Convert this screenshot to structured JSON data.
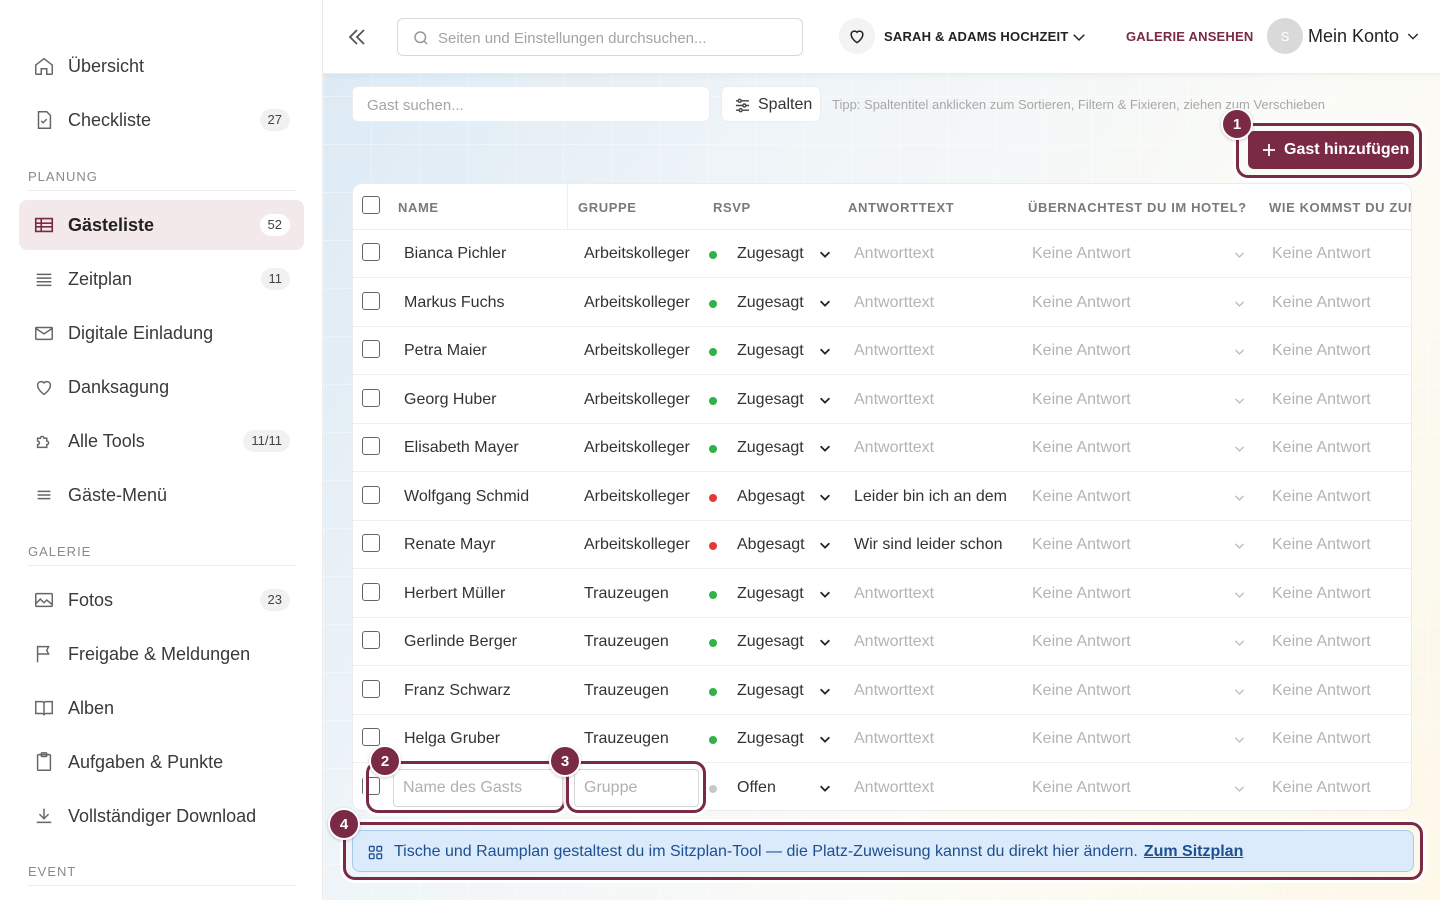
{
  "sidebar": {
    "top_items": [
      {
        "label": "Übersicht",
        "badge": null,
        "icon": "home-icon"
      },
      {
        "label": "Checkliste",
        "badge": "27",
        "icon": "checklist-icon"
      }
    ],
    "sections": [
      {
        "title": "PLANUNG"
      },
      {
        "title": "GALERIE"
      },
      {
        "title": "EVENT"
      }
    ],
    "planung_items": [
      {
        "label": "Gästeliste",
        "badge": "52",
        "icon": "table-icon"
      },
      {
        "label": "Zeitplan",
        "badge": "11",
        "icon": "lines-icon"
      },
      {
        "label": "Digitale Einladung",
        "badge": null,
        "icon": "mail-icon"
      },
      {
        "label": "Danksagung",
        "badge": null,
        "icon": "heart-icon"
      },
      {
        "label": "Alle Tools",
        "badge": "11/11",
        "icon": "puzzle-icon"
      },
      {
        "label": "Gäste-Menü",
        "badge": null,
        "icon": "menu-icon"
      }
    ],
    "galerie_items": [
      {
        "label": "Fotos",
        "badge": "23",
        "icon": "image-icon"
      },
      {
        "label": "Freigabe & Meldungen",
        "badge": null,
        "icon": "flag-icon"
      },
      {
        "label": "Alben",
        "badge": null,
        "icon": "book-icon"
      },
      {
        "label": "Aufgaben & Punkte",
        "badge": null,
        "icon": "clipboard-icon"
      },
      {
        "label": "Vollständiger Download",
        "badge": null,
        "icon": "download-icon"
      }
    ]
  },
  "topbar": {
    "search_placeholder": "Seiten und Einstellungen durchsuchen...",
    "event_name": "SARAH & ADAMS HOCHZEIT",
    "gallery_link": "GALERIE ANSEHEN",
    "avatar_initial": "S",
    "account_label": "Mein Konto"
  },
  "toolbar": {
    "guest_search_placeholder": "Gast suchen...",
    "columns_label": "Spalten",
    "tip": "Tipp: Spaltentitel anklicken zum Sortieren, Filtern & Fixieren, ziehen zum Verschieben",
    "add_guest_label": "Gast hinzufügen"
  },
  "table": {
    "headers": [
      "NAME",
      "GRUPPE",
      "RSVP",
      "ANTWORTTEXT",
      "ÜBERNACHTEST DU IM HOTEL?",
      "WIE KOMMST DU ZUM"
    ],
    "rows": [
      {
        "name": "Bianca Pichler",
        "group": "Arbeitskolleger",
        "rsvp": "Zugesagt",
        "status": "yes",
        "text": "Antworttext",
        "text_placeholder": true,
        "hotel": "Keine Antwort",
        "travel": "Keine Antwort"
      },
      {
        "name": "Markus Fuchs",
        "group": "Arbeitskolleger",
        "rsvp": "Zugesagt",
        "status": "yes",
        "text": "Antworttext",
        "text_placeholder": true,
        "hotel": "Keine Antwort",
        "travel": "Keine Antwort"
      },
      {
        "name": "Petra Maier",
        "group": "Arbeitskolleger",
        "rsvp": "Zugesagt",
        "status": "yes",
        "text": "Antworttext",
        "text_placeholder": true,
        "hotel": "Keine Antwort",
        "travel": "Keine Antwort"
      },
      {
        "name": "Georg Huber",
        "group": "Arbeitskolleger",
        "rsvp": "Zugesagt",
        "status": "yes",
        "text": "Antworttext",
        "text_placeholder": true,
        "hotel": "Keine Antwort",
        "travel": "Keine Antwort"
      },
      {
        "name": "Elisabeth Mayer",
        "group": "Arbeitskolleger",
        "rsvp": "Zugesagt",
        "status": "yes",
        "text": "Antworttext",
        "text_placeholder": true,
        "hotel": "Keine Antwort",
        "travel": "Keine Antwort"
      },
      {
        "name": "Wolfgang Schmid",
        "group": "Arbeitskolleger",
        "rsvp": "Abgesagt",
        "status": "no",
        "text": "Leider bin ich an dem",
        "text_placeholder": false,
        "hotel": "Keine Antwort",
        "travel": "Keine Antwort"
      },
      {
        "name": "Renate Mayr",
        "group": "Arbeitskolleger",
        "rsvp": "Abgesagt",
        "status": "no",
        "text": "Wir sind leider schon",
        "text_placeholder": false,
        "hotel": "Keine Antwort",
        "travel": "Keine Antwort"
      },
      {
        "name": "Herbert Müller",
        "group": "Trauzeugen",
        "rsvp": "Zugesagt",
        "status": "yes",
        "text": "Antworttext",
        "text_placeholder": true,
        "hotel": "Keine Antwort",
        "travel": "Keine Antwort"
      },
      {
        "name": "Gerlinde Berger",
        "group": "Trauzeugen",
        "rsvp": "Zugesagt",
        "status": "yes",
        "text": "Antworttext",
        "text_placeholder": true,
        "hotel": "Keine Antwort",
        "travel": "Keine Antwort"
      },
      {
        "name": "Franz Schwarz",
        "group": "Trauzeugen",
        "rsvp": "Zugesagt",
        "status": "yes",
        "text": "Antworttext",
        "text_placeholder": true,
        "hotel": "Keine Antwort",
        "travel": "Keine Antwort"
      },
      {
        "name": "Helga Gruber",
        "group": "Trauzeugen",
        "rsvp": "Zugesagt",
        "status": "yes",
        "text": "Antworttext",
        "text_placeholder": true,
        "hotel": "Keine Antwort",
        "travel": "Keine Antwort"
      }
    ],
    "new_row": {
      "name_placeholder": "Name des Gasts",
      "group_placeholder": "Gruppe",
      "rsvp": "Offen",
      "text": "Antworttext",
      "hotel": "Keine Antwort",
      "travel": "Keine Antwort"
    }
  },
  "markers": [
    "1",
    "2",
    "3",
    "4"
  ],
  "banner": {
    "text": "Tische und Raumplan gestaltest du im Sitzplan-Tool — die Platz-Zuweisung kannst du direkt hier ändern.",
    "link": "Zum Sitzplan"
  },
  "colors": {
    "accent": "#7a2a44",
    "active_bg": "#f3e8ea",
    "status_yes": "#2fb344",
    "status_no": "#e53935",
    "status_open": "#c8c8c8",
    "banner_bg": "#dcebfb",
    "banner_text": "#1d4f91"
  }
}
